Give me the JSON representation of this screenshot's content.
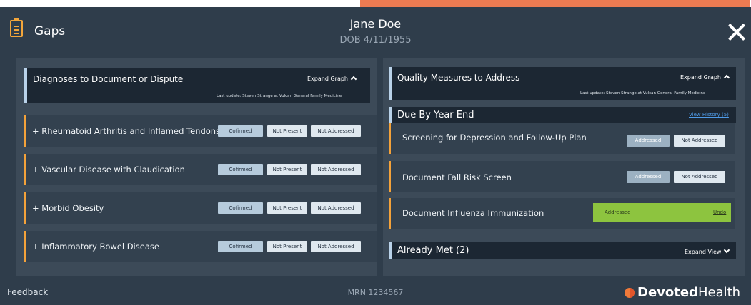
{
  "header": {
    "title": "Gaps",
    "patient_name": "Jane Doe",
    "patient_dob": "DOB 4/11/1955",
    "icon": "clipboard-icon",
    "close_icon": "close-icon"
  },
  "left_panel": {
    "title": "Diagnoses to Document or Dispute",
    "expand_label": "Expand Graph",
    "last_update": "Last update: Steven Strange at Vulcan General Family Medicine",
    "diagnoses": [
      {
        "label": "+ Rheumatoid Arthritis and Inflamed Tendons",
        "confirmed": "Cofirmed",
        "not_present": "Not Present",
        "not_addressed": "Not Addressed"
      },
      {
        "label": "+ Vascular Disease with Claudication",
        "confirmed": "Cofirmed",
        "not_present": "Not Present",
        "not_addressed": "Not Addressed"
      },
      {
        "label": "+ Morbid Obesity",
        "confirmed": "Cofirmed",
        "not_present": "Not Present",
        "not_addressed": "Not Addressed"
      },
      {
        "label": "+ Inflammatory Bowel Disease",
        "confirmed": "Cofirmed",
        "not_present": "Not Present",
        "not_addressed": "Not Addressed"
      }
    ]
  },
  "right_panel": {
    "title": "Quality Measures to Address",
    "expand_label": "Expand Graph",
    "last_update": "Last update: Steven Strange at Vulcan General Family Medicine",
    "due_by_year_end": {
      "title": "Due By Year End",
      "history_link": "View History (5)",
      "measures": [
        {
          "label": "Screening for Depression and Follow-Up Plan",
          "addressed": "Addressed",
          "not_addressed": "Not Addressed"
        },
        {
          "label": "Document Fall Risk Screen",
          "addressed": "Addressed",
          "not_addressed": "Not Addressed"
        },
        {
          "label": "Document Influenza Immunization",
          "addressed_status": "Addressed",
          "undo": "Undo"
        }
      ]
    },
    "already_met": {
      "title": "Already Met (2)",
      "expand_label": "Expand View"
    }
  },
  "footer": {
    "feedback": "Feedback",
    "mrn": "MRN 1234567",
    "brand_bold": "Devoted",
    "brand_light": "Health"
  },
  "colors": {
    "background": "#2f3d4b",
    "accent_orange": "#ec7b52",
    "row_marker": "#f4a23a",
    "addressed_green": "#8dc43f",
    "link_blue": "#4f9be8"
  }
}
